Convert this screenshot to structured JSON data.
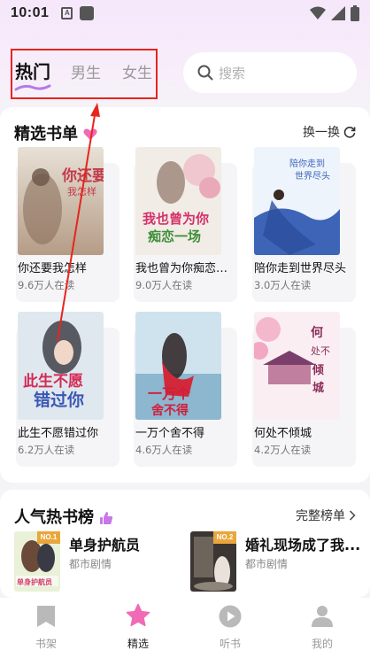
{
  "status_bar": {
    "time": "10:01",
    "notif_icon_letter": "A"
  },
  "tabs": [
    {
      "label": "热门",
      "active": true
    },
    {
      "label": "男生",
      "active": false
    },
    {
      "label": "女生",
      "active": false
    }
  ],
  "search": {
    "placeholder": "搜索"
  },
  "featured": {
    "title": "精选书单",
    "action": "换一换",
    "books": [
      {
        "title": "你还要我怎样",
        "readers": "9.6万人在读",
        "cover_text": "你还要我怎样"
      },
      {
        "title": "我也曾为你痴恋一场",
        "readers": "9.0万人在读",
        "cover_text": "我也曾为你痴恋一场"
      },
      {
        "title": "陪你走到世界尽头",
        "readers": "3.0万人在读",
        "cover_text": "陪你走到世界尽头"
      },
      {
        "title": "此生不愿错过你",
        "readers": "6.2万人在读",
        "cover_text": "此生不愿错过你"
      },
      {
        "title": "一万个舍不得",
        "readers": "4.6万人在读",
        "cover_text": "一万个舍不得"
      },
      {
        "title": "何处不倾城",
        "readers": "4.2万人在读",
        "cover_text": "何处不倾城"
      }
    ]
  },
  "ranking": {
    "title": "人气热书榜",
    "action": "完整榜单",
    "items": [
      {
        "badge": "NO.1",
        "title": "单身护航员",
        "genre": "都市剧情",
        "cover_text": "单身护航员"
      },
      {
        "badge": "NO.2",
        "title": "婚礼现场成了我...",
        "genre": "都市剧情"
      }
    ]
  },
  "bottom_nav": [
    {
      "label": "书架",
      "icon": "bookmark-icon",
      "active": false
    },
    {
      "label": "精选",
      "icon": "star-icon",
      "active": true
    },
    {
      "label": "听书",
      "icon": "play-icon",
      "active": false
    },
    {
      "label": "我的",
      "icon": "person-icon",
      "active": false
    }
  ],
  "colors": {
    "accent_pink": "#f06ab6",
    "annotation_red": "#e8241f",
    "rank_badge": "#e9a63a"
  }
}
